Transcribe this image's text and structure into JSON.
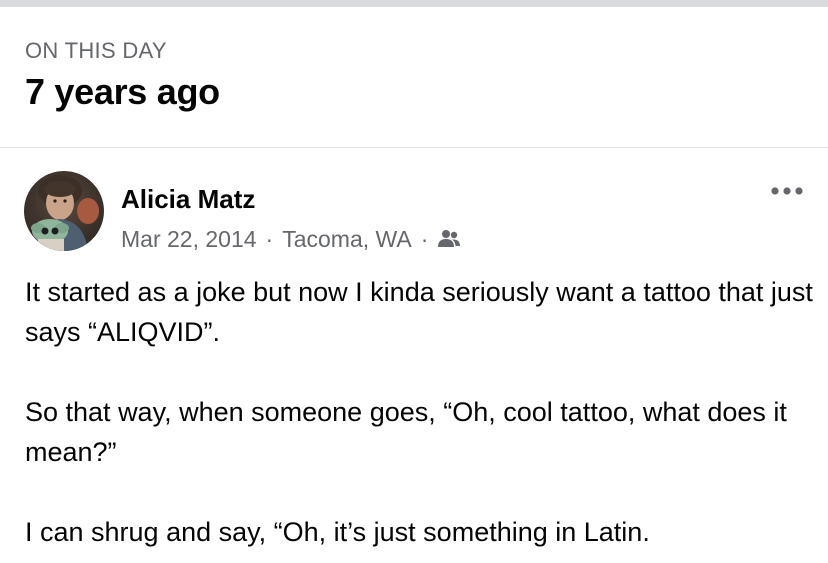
{
  "memory": {
    "section_label": "ON THIS DAY",
    "years_ago": "7 years ago"
  },
  "post": {
    "author": "Alicia Matz",
    "date": "Mar 22, 2014",
    "separator": "·",
    "location": "Tacoma, WA",
    "audience_icon": "friends-icon",
    "more_icon": "more-options-icon",
    "paragraphs": [
      "It started as a joke but now I kinda seriously want a tattoo that just says “ALIQVID”.",
      "So that way, when someone goes, “Oh, cool tattoo, what does it mean?”",
      "I can shrug and say, “Oh, it’s just something in Latin."
    ]
  },
  "colors": {
    "secondary_text": "#65676b",
    "primary_text": "#050505",
    "divider": "#dadde1",
    "top_bar": "#d9dadd"
  }
}
